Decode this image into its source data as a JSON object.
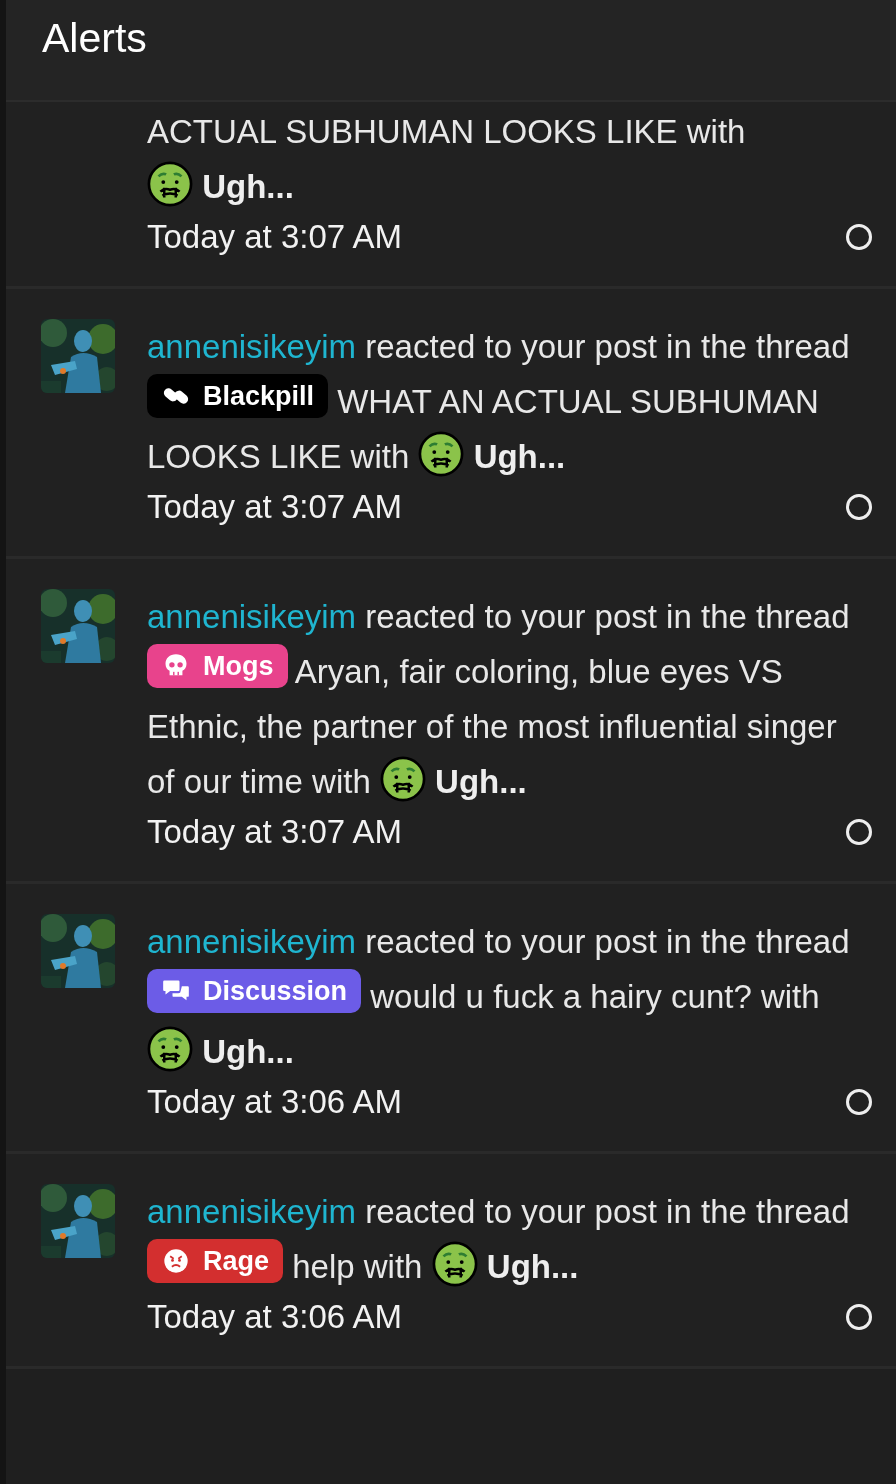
{
  "header": {
    "title": "Alerts"
  },
  "alerts": [
    {
      "kind": "partial",
      "text_tail": "ACTUAL SUBHUMAN LOOKS LIKE with",
      "reaction": "Ugh...",
      "time": "Today at 3:07 AM"
    },
    {
      "kind": "full",
      "user": "annenisikeyim",
      "action": "reacted to your post in the thread",
      "prefix": {
        "label": "Blackpill",
        "color": "#000000"
      },
      "title": "WHAT AN ACTUAL SUBHUMAN LOOKS LIKE",
      "with": "with",
      "reaction": "Ugh...",
      "time": "Today at 3:07 AM"
    },
    {
      "kind": "full",
      "user": "annenisikeyim",
      "action": "reacted to your post in the thread",
      "prefix": {
        "label": "Mogs",
        "color": "#e8438c"
      },
      "title": "Aryan, fair coloring, blue eyes VS Ethnic, the partner of the most influential singer of our time",
      "with": "with",
      "reaction": "Ugh...",
      "time": "Today at 3:07 AM"
    },
    {
      "kind": "full",
      "user": "annenisikeyim",
      "action": "reacted to your post in the thread",
      "prefix": {
        "label": "Discussion",
        "color": "#6c5ce7"
      },
      "title": "would u fuck a hairy cunt?",
      "with": "with",
      "reaction": "Ugh...",
      "time": "Today at 3:06 AM"
    },
    {
      "kind": "full",
      "user": "annenisikeyim",
      "action": "reacted to your post in the thread",
      "prefix": {
        "label": "Rage",
        "color": "#d32f2f"
      },
      "title": "help",
      "with": "with",
      "reaction": "Ugh...",
      "time": "Today at 3:06 AM"
    }
  ]
}
